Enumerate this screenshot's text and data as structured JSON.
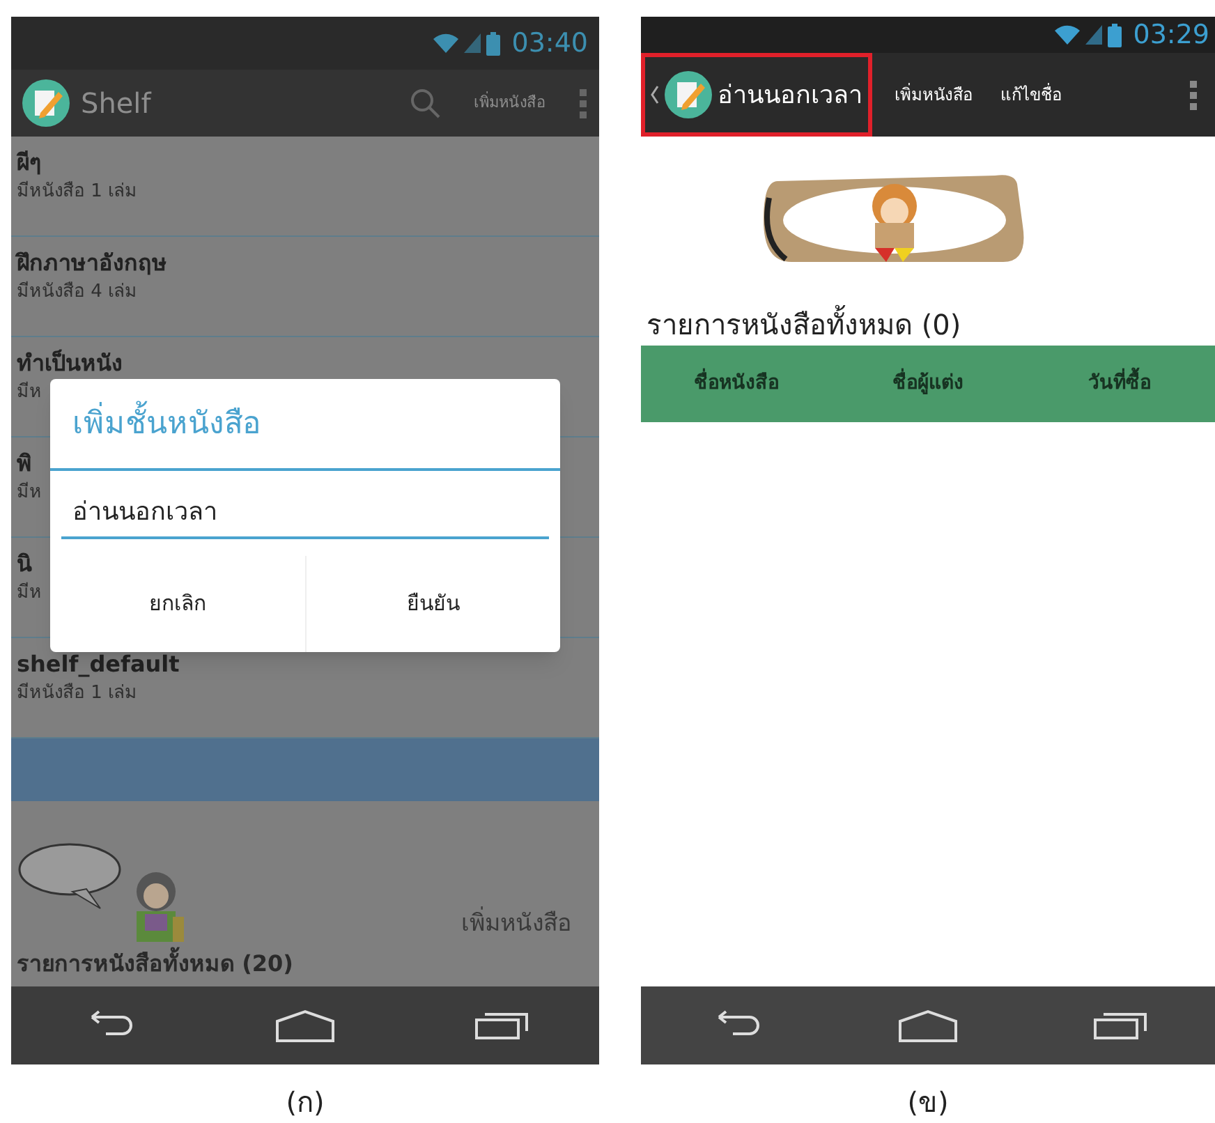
{
  "screen_a": {
    "status_bar": {
      "time": "03:40"
    },
    "action_bar": {
      "title": "Shelf",
      "action": "เพิ่มหนังสือ"
    },
    "shelves": [
      {
        "name": "ผีๆ",
        "count": "มีหนังสือ 1 เล่ม",
        "selected": false
      },
      {
        "name": "ฝึกภาษาอังกฤษ",
        "count": "มีหนังสือ 4 เล่ม",
        "selected": false
      },
      {
        "name": "ทำเป็นหนัง",
        "count": "มีห",
        "selected": false
      },
      {
        "name": "พิ",
        "count": "มีห",
        "selected": false
      },
      {
        "name": "นิ",
        "count": "มีห",
        "selected": false
      },
      {
        "name": "shelf_default",
        "count": "มีหนังสือ 1 เล่ม",
        "selected": false
      },
      {
        "selected": true
      }
    ],
    "dialog": {
      "title": "เพิ่มชั้นหนังสือ",
      "value": "อ่านนอกเวลา",
      "buttons": [
        "ยกเลิก",
        "ยืนยัน"
      ]
    },
    "footer": {
      "add_button": "เพิ่มหนังสือ",
      "list_title": "รายการหนังสือทั้งหมด (20)"
    },
    "caption": "(ก)"
  },
  "screen_b": {
    "status_bar": {
      "time": "03:29"
    },
    "action_bar": {
      "title": "อ่านนอกเวลา",
      "actions": [
        "เพิ่มหนังสือ",
        "แก้ไขชื่อ"
      ]
    },
    "list_title": "รายการหนังสือทั้งหมด (0)",
    "table": {
      "columns": [
        "ชื่อหนังสือ",
        "ชื่อผู้แต่ง",
        "วันที่ซื้อ"
      ]
    },
    "caption": "(ข)"
  }
}
